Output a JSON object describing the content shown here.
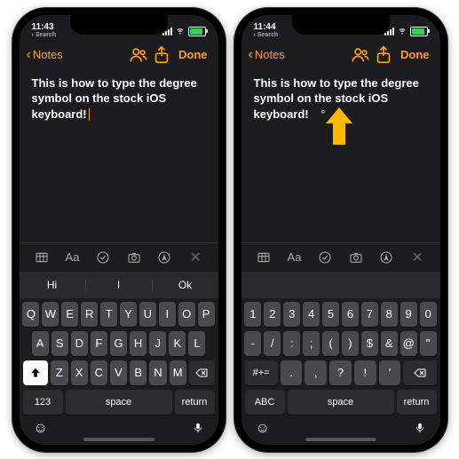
{
  "left": {
    "status": {
      "time": "11:43",
      "search_label": "Search"
    },
    "nav": {
      "back": "Notes",
      "done": "Done"
    },
    "note_text": "This is how to type the degree symbol on the stock iOS keyboard!",
    "suggestions": [
      "Hi",
      "I",
      "Ok"
    ],
    "keyboard": {
      "row1": [
        "Q",
        "W",
        "E",
        "R",
        "T",
        "Y",
        "U",
        "I",
        "O",
        "P"
      ],
      "row2": [
        "A",
        "S",
        "D",
        "F",
        "G",
        "H",
        "J",
        "K",
        "L"
      ],
      "row3": [
        "Z",
        "X",
        "C",
        "V",
        "B",
        "N",
        "M"
      ],
      "mode_key": "123",
      "space": "space",
      "return": "return"
    }
  },
  "right": {
    "status": {
      "time": "11:44",
      "search_label": "Search"
    },
    "nav": {
      "back": "Notes",
      "done": "Done"
    },
    "note_text": "This is how to type the degree symbol on the stock iOS keyboard!",
    "degree": "°",
    "keyboard": {
      "row1": [
        "1",
        "2",
        "3",
        "4",
        "5",
        "6",
        "7",
        "8",
        "9",
        "0"
      ],
      "row2": [
        "-",
        "/",
        ":",
        ";",
        "(",
        ")",
        "$",
        "&",
        "@",
        "\""
      ],
      "row3_shift": "#+=",
      "row3": [
        ".",
        ",",
        "?",
        "!",
        "'"
      ],
      "mode_key": "ABC",
      "space": "space",
      "return": "return"
    }
  }
}
